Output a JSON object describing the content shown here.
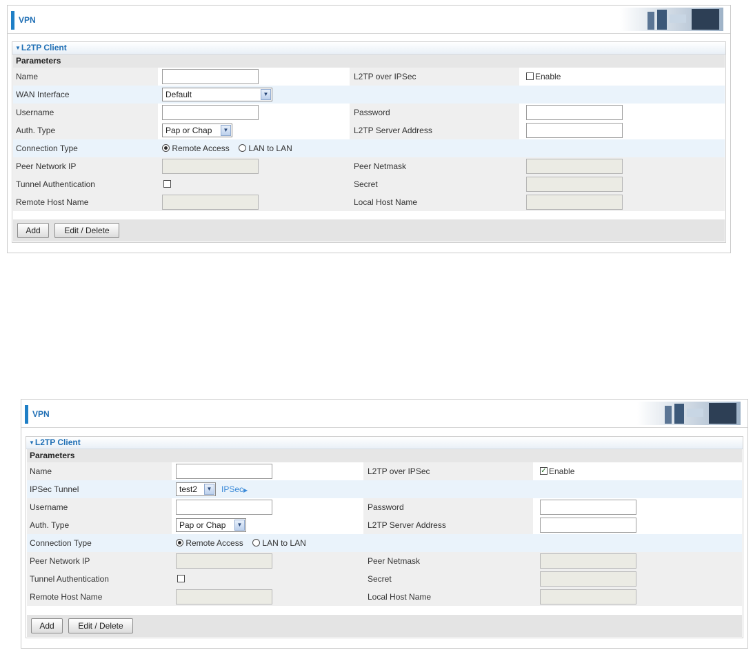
{
  "panels": [
    {
      "header": {
        "title": "VPN"
      },
      "section_title": "L2TP Client",
      "params_header": "Parameters",
      "fields": {
        "name_label": "Name",
        "l2tp_ipsec_label": "L2TP over IPSec",
        "enable_label": "Enable",
        "enable_checked": false,
        "interface_label": "WAN Interface",
        "interface_value": "Default",
        "username_label": "Username",
        "password_label": "Password",
        "auth_label": "Auth. Type",
        "auth_value": "Pap or Chap",
        "server_label": "L2TP Server Address",
        "conn_label": "Connection Type",
        "remote_access_label": "Remote Access",
        "lan_to_lan_label": "LAN to LAN",
        "peer_ip_label": "Peer Network IP",
        "peer_mask_label": "Peer Netmask",
        "tunnel_auth_label": "Tunnel Authentication",
        "secret_label": "Secret",
        "remote_host_label": "Remote Host Name",
        "local_host_label": "Local Host Name"
      },
      "buttons": {
        "add": "Add",
        "edit_delete": "Edit / Delete"
      }
    },
    {
      "header": {
        "title": "VPN"
      },
      "section_title": "L2TP Client",
      "params_header": "Parameters",
      "fields": {
        "name_label": "Name",
        "l2tp_ipsec_label": "L2TP over IPSec",
        "enable_label": "Enable",
        "enable_checked": true,
        "interface_label": "IPSec Tunnel",
        "interface_value": "test2",
        "ipsec_link": "IPSec",
        "username_label": "Username",
        "password_label": "Password",
        "auth_label": "Auth. Type",
        "auth_value": "Pap or Chap",
        "server_label": "L2TP Server Address",
        "conn_label": "Connection Type",
        "remote_access_label": "Remote Access",
        "lan_to_lan_label": "LAN to LAN",
        "peer_ip_label": "Peer Network IP",
        "peer_mask_label": "Peer Netmask",
        "tunnel_auth_label": "Tunnel Authentication",
        "secret_label": "Secret",
        "remote_host_label": "Remote Host Name",
        "local_host_label": "Local Host Name"
      },
      "buttons": {
        "add": "Add",
        "edit_delete": "Edit / Delete"
      }
    }
  ],
  "colors": {
    "accent": "#1f7fc6",
    "link": "#3b8ad8"
  }
}
